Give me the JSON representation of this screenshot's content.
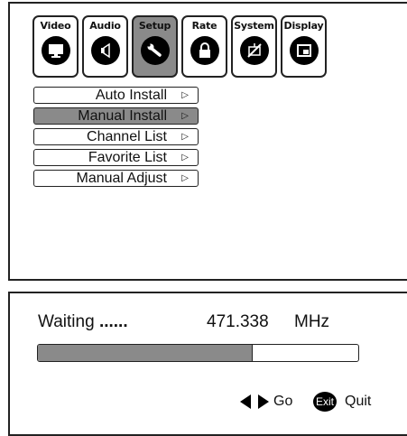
{
  "tabs": [
    {
      "label": "Video",
      "icon": "monitor-icon",
      "active": false
    },
    {
      "label": "Audio",
      "icon": "speaker-icon",
      "active": false
    },
    {
      "label": "Setup",
      "icon": "wrench-icon",
      "active": true
    },
    {
      "label": "Rate",
      "icon": "lock-icon",
      "active": false
    },
    {
      "label": "System",
      "icon": "no-antenna-icon",
      "active": false
    },
    {
      "label": "Display",
      "icon": "screen-icon",
      "active": false
    }
  ],
  "menu": {
    "items": [
      {
        "label": "Auto Install",
        "selected": false
      },
      {
        "label": "Manual Install",
        "selected": true
      },
      {
        "label": "Channel List",
        "selected": false
      },
      {
        "label": "Favorite List",
        "selected": false
      },
      {
        "label": "Manual Adjust",
        "selected": false
      }
    ],
    "arrow_glyph": "▷"
  },
  "status": {
    "label": "Waiting",
    "dots": "......",
    "frequency": "471.338",
    "unit": "MHz",
    "progress_percent": 67
  },
  "footer": {
    "go_label": "Go",
    "exit_badge": "Exit",
    "quit_label": "Quit"
  },
  "colors": {
    "selected_fill": "#8a8a8a",
    "border": "#222222",
    "icon_bg": "#000000"
  }
}
